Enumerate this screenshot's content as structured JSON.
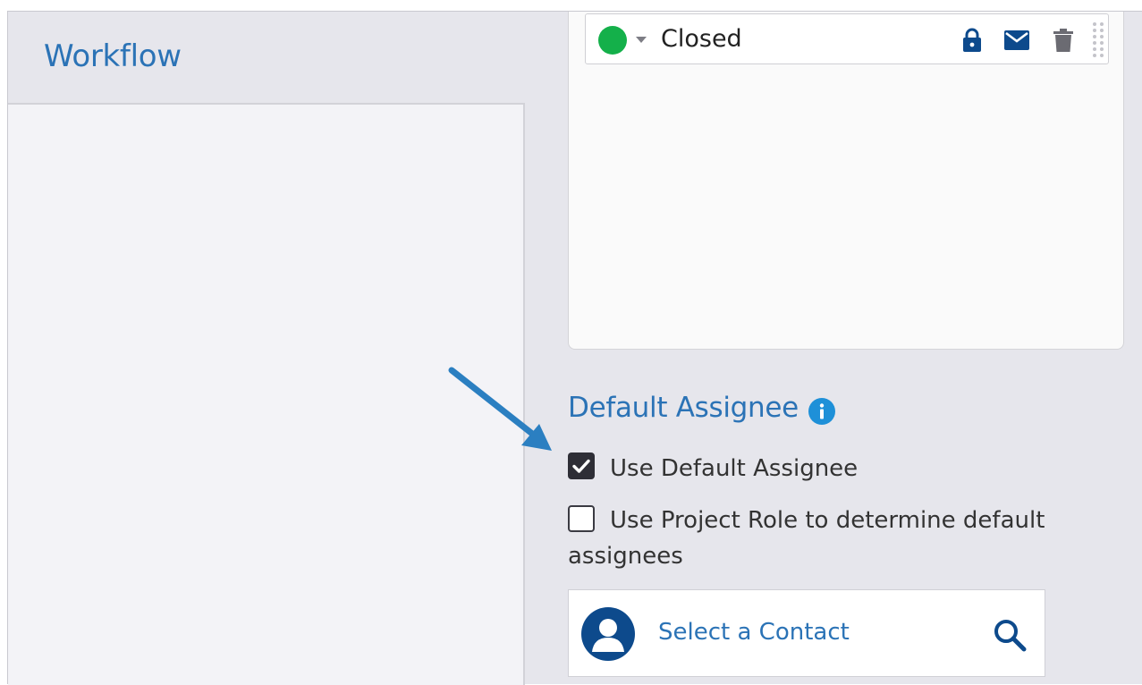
{
  "workflow": {
    "title": "Workflow"
  },
  "status": {
    "label": "Closed",
    "dot_color": "#14b04a",
    "icons": [
      "lock-icon",
      "mail-icon",
      "trash-icon",
      "drag-handle-icon"
    ]
  },
  "default_assignee": {
    "title": "Default Assignee",
    "info_icon": "info-icon",
    "use_default": {
      "label": "Use Default Assignee",
      "checked": true
    },
    "use_project_role": {
      "label": "Use Project Role to determine default assignees",
      "checked": false
    },
    "contact": {
      "placeholder": "Select a Contact"
    }
  },
  "colors": {
    "accent": "#2b73b6",
    "icon_blue": "#0d4a8c",
    "arrow": "#2b7fc1"
  }
}
